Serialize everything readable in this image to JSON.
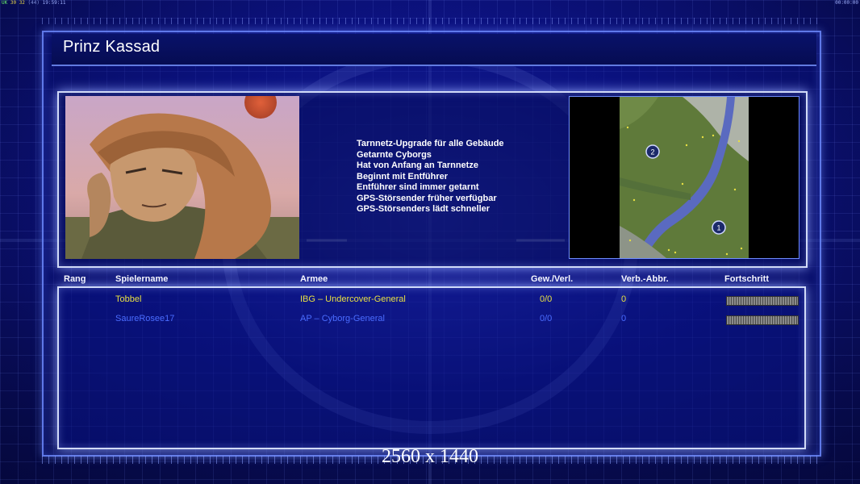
{
  "status": {
    "left_a": "UK",
    "left_b": "30 32",
    "left_c": "(44)",
    "left_d": "19:59:11",
    "right": "00:00:00"
  },
  "page_title": "Prinz Kassad",
  "features": [
    "Tarnnetz-Upgrade für alle Gebäude",
    "Getarnte Cyborgs",
    "Hat von Anfang an Tarnnetze",
    "Beginnt mit Entführer",
    "Entführer sind immer getarnt",
    "GPS-Störsender früher verfügbar",
    "GPS-Störsenders lädt schneller"
  ],
  "minimap": {
    "start_positions": [
      "2",
      "1"
    ]
  },
  "players_table": {
    "columns": [
      "Rang",
      "Spielername",
      "Armee",
      "Gew./Verl.",
      "Verb.-Abbr.",
      "Fortschritt"
    ],
    "rows": [
      {
        "rank": "",
        "name": "Tobbel",
        "army": "IBG – Undercover-General",
        "wins_losses": "0/0",
        "disconnects": "0",
        "progress_percent": 100,
        "color": "#e8e042"
      },
      {
        "rank": "",
        "name": "SaureRosee17",
        "army": "AP – Cyborg-General",
        "wins_losses": "0/0",
        "disconnects": "0",
        "progress_percent": 100,
        "color": "#4a6cff"
      }
    ]
  },
  "resolution_label": "2560 x 1440"
}
